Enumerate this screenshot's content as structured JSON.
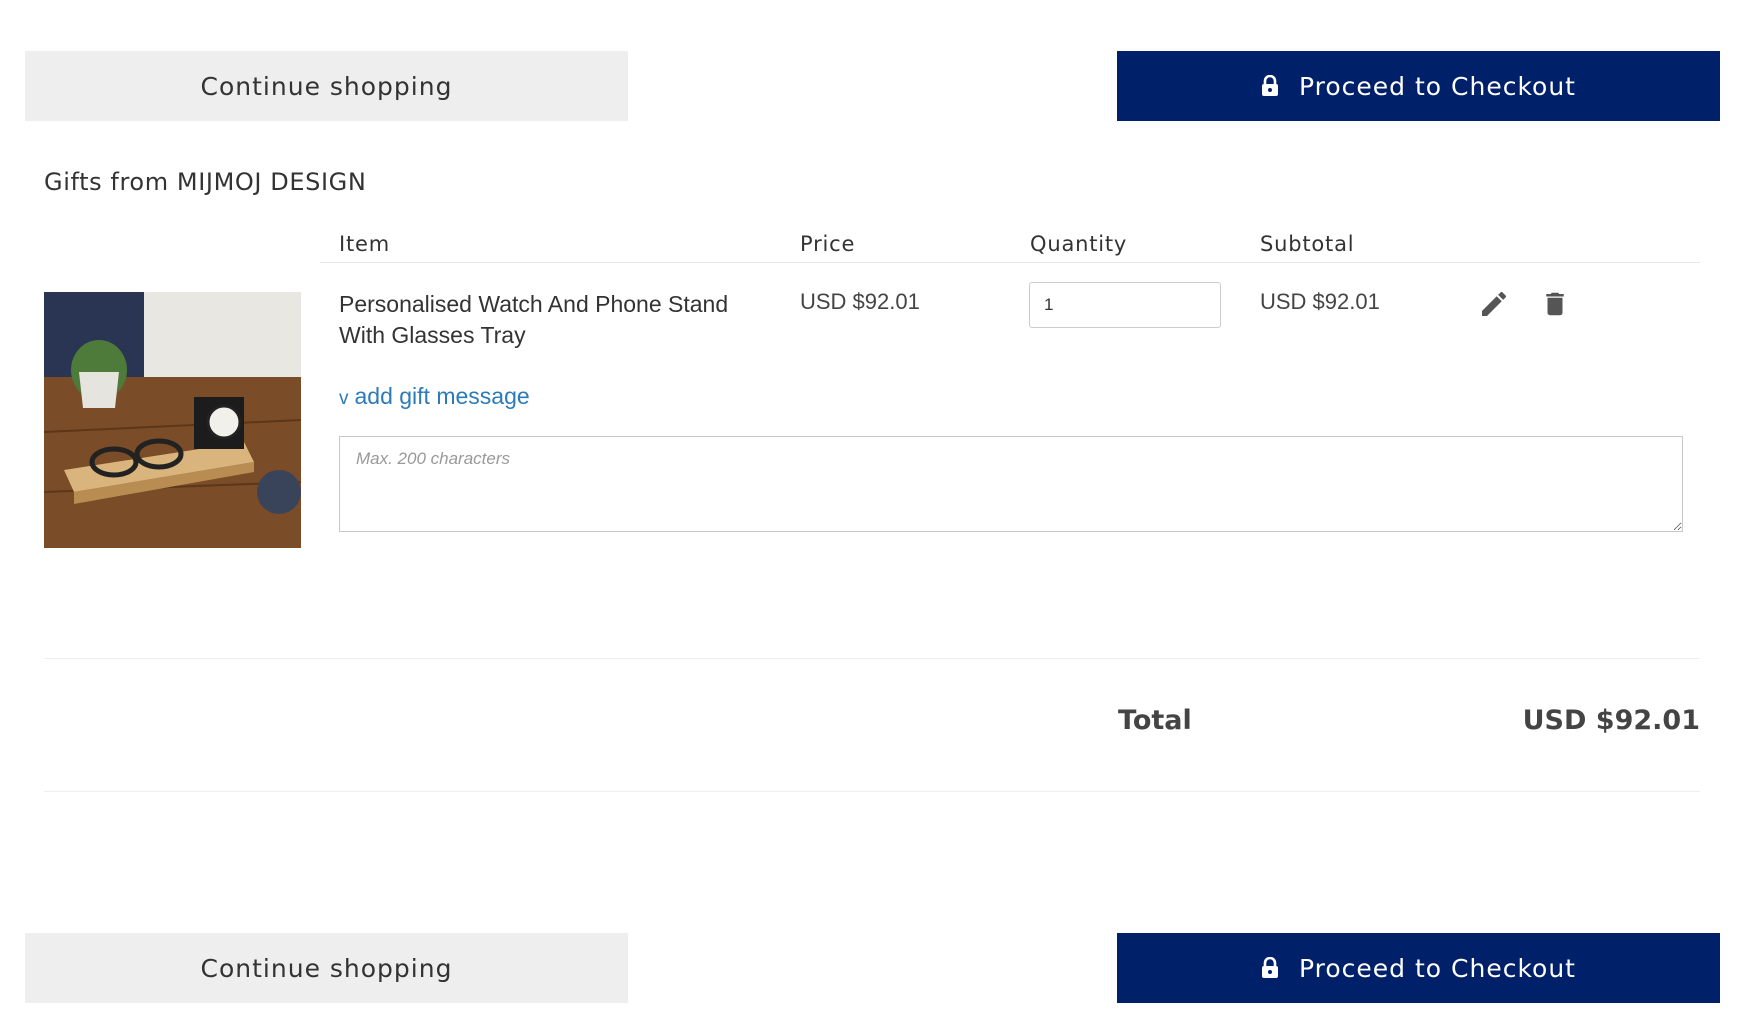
{
  "actions": {
    "continue_label": "Continue shopping",
    "checkout_label": "Proceed to Checkout"
  },
  "section": {
    "title": "Gifts from MIJMOJ DESIGN"
  },
  "table": {
    "headers": [
      "Item",
      "Price",
      "Quantity",
      "Subtotal"
    ]
  },
  "cart_item": {
    "name": "Personalised Watch And Phone Stand With Glasses Tray",
    "price": "USD $92.01",
    "quantity": "1",
    "subtotal": "USD $92.01",
    "image_icon": "product-photo-watch-stand"
  },
  "gift": {
    "toggle_label": "add gift message",
    "placeholder": "Max. 200 characters"
  },
  "summary": {
    "total_label": "Total",
    "total_value": "USD $92.01"
  },
  "colors": {
    "primary": "#002169",
    "secondary_bg": "#eeeeee",
    "link": "#2b7bb9"
  }
}
